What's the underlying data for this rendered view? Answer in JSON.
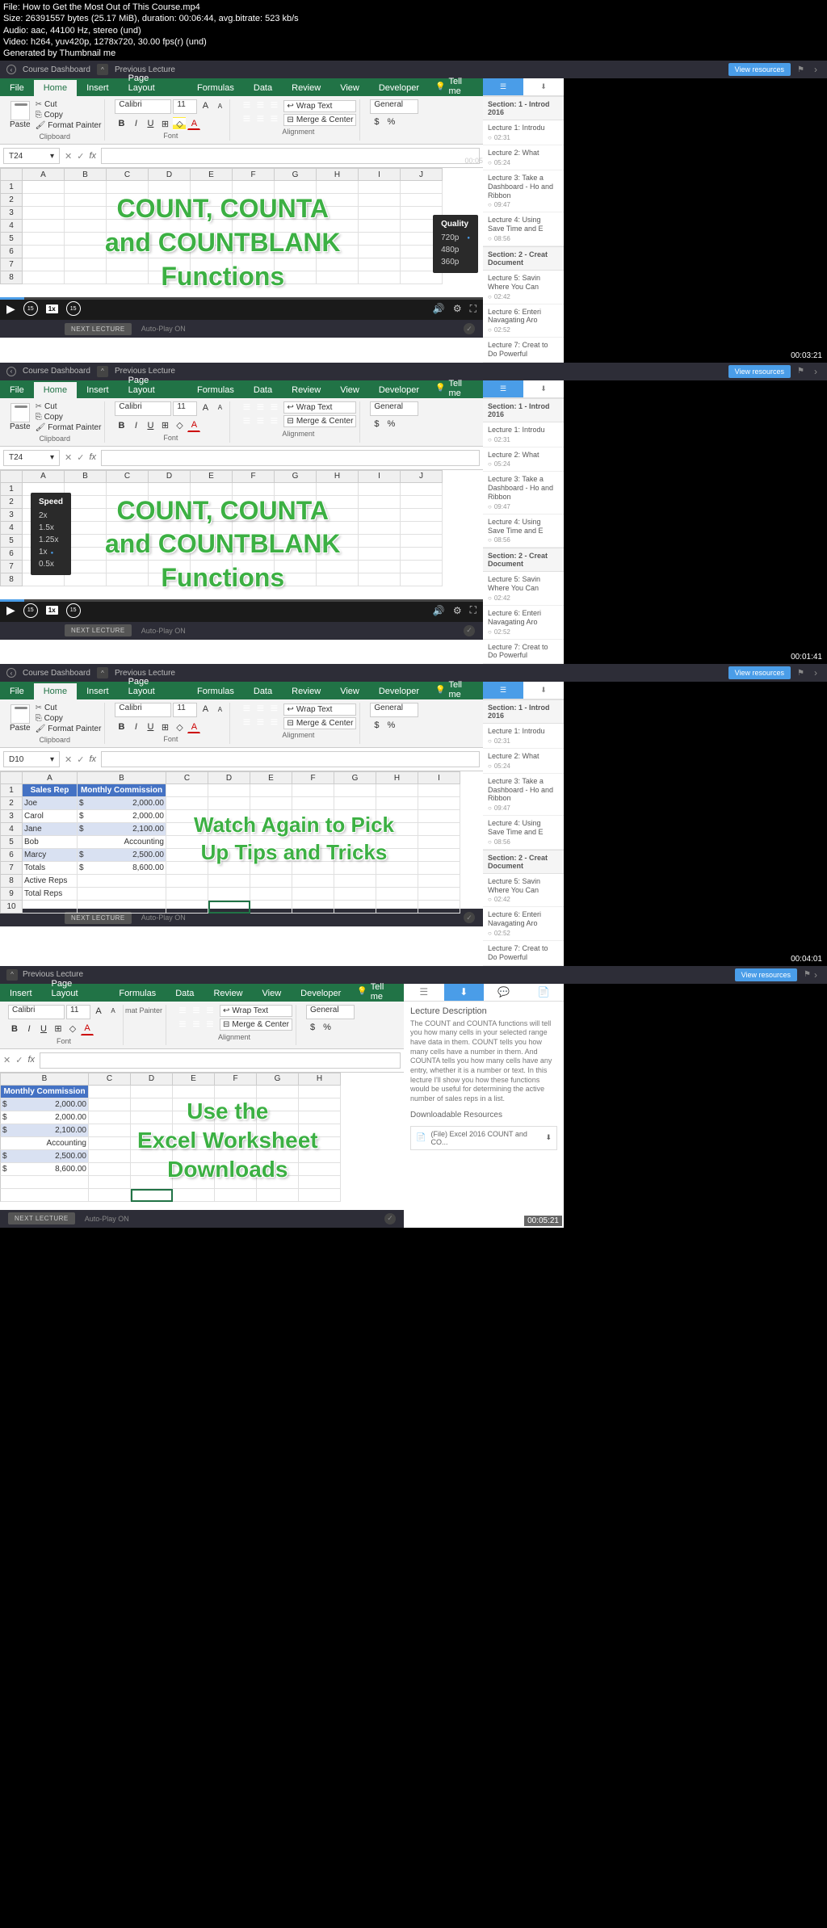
{
  "meta": {
    "file": "File: How to Get the Most Out of This Course.mp4",
    "size": "Size: 26391557 bytes (25.17 MiB), duration: 00:06:44, avg.bitrate: 523 kb/s",
    "audio": "Audio: aac, 44100 Hz, stereo (und)",
    "video": "Video: h264, yuv420p, 1278x720, 30.00 fps(r) (und)",
    "gen": "Generated by Thumbnail me"
  },
  "topbar": {
    "dashboard": "Course Dashboard",
    "prev": "Previous Lecture",
    "viewres": "View resources"
  },
  "excel": {
    "tabs": {
      "file": "File",
      "home": "Home",
      "insert": "Insert",
      "pagelayout": "Page Layout",
      "formulas": "Formulas",
      "data": "Data",
      "review": "Review",
      "view": "View",
      "developer": "Developer",
      "tellme": "Tell me"
    },
    "clipboard": {
      "paste": "Paste",
      "cut": "Cut",
      "copy": "Copy",
      "painter": "Format Painter",
      "label": "Clipboard"
    },
    "font": {
      "name": "Calibri",
      "size": "11",
      "label": "Font"
    },
    "alignment": {
      "wrap": "Wrap Text",
      "merge": "Merge & Center",
      "label": "Alignment"
    },
    "number": {
      "general": "General"
    },
    "namebox1": "T24",
    "namebox3": "D10"
  },
  "cols": [
    "A",
    "B",
    "C",
    "D",
    "E",
    "F",
    "G",
    "H",
    "I",
    "J"
  ],
  "overlay1": {
    "l1": "COUNT, COUNTA",
    "l2": "and COUNTBLANK",
    "l3": "Functions"
  },
  "overlay3": {
    "l1": "Watch Again to Pick",
    "l2": "Up Tips and Tricks"
  },
  "overlay4": {
    "l1": "Use the",
    "l2": "Excel Worksheet",
    "l3": "Downloads"
  },
  "quality": {
    "title": "Quality",
    "q720": "720p",
    "q480": "480p",
    "q360": "360p"
  },
  "speed": {
    "title": "Speed",
    "s2": "2x",
    "s15": "1.5x",
    "s125": "1.25x",
    "s1": "1x",
    "s05": "0.5x"
  },
  "controls": {
    "rewind": "15",
    "speed": "1x",
    "ffwd": "15"
  },
  "nextbar": {
    "next": "NEXT LECTURE",
    "autoplay": "Auto-Play ON"
  },
  "sidebar": {
    "sec1": "Section: 1 - Introd 2016",
    "l1": {
      "t": "Lecture 1: Introdu",
      "d": "02:31"
    },
    "l2": {
      "t": "Lecture 2: What",
      "d": "05:24"
    },
    "l3": {
      "t": "Lecture 3: Take a Dashboard - Ho and Ribbon",
      "d": "09:47"
    },
    "l4": {
      "t": "Lecture 4: Using Save Time and E",
      "d": "08:56"
    },
    "sec2": "Section: 2 - Creat Document",
    "l5": {
      "t": "Lecture 5: Savin Where You Can",
      "d": "02:42"
    },
    "l6": {
      "t": "Lecture 6: Enteri Navagating Aro",
      "d": "02:52"
    },
    "l7": {
      "t": "Lecture 7: Creat to Do Powerful"
    }
  },
  "timestamps": {
    "t1": "00:05",
    "t3": "00:03:21",
    "t4": "00:01:41",
    "t5": "00:04:01",
    "t6": "00:05:21"
  },
  "table": {
    "h1": "Sales Rep",
    "h2": "Monthly Commission",
    "r1": {
      "name": "Joe",
      "cur": "$",
      "val": "2,000.00"
    },
    "r2": {
      "name": "Carol",
      "cur": "$",
      "val": "2,000.00"
    },
    "r3": {
      "name": "Jane",
      "cur": "$",
      "val": "2,100.00"
    },
    "r4": {
      "name": "Bob",
      "val": "Accounting"
    },
    "r5": {
      "name": "Marcy",
      "cur": "$",
      "val": "2,500.00"
    },
    "r6": {
      "name": "Totals",
      "cur": "$",
      "val": "8,600.00"
    },
    "r7": {
      "name": "Active Reps"
    },
    "r8": {
      "name": "Total Reps"
    }
  },
  "desc": {
    "title": "Lecture Description",
    "text": "The COUNT and COUNTA functions will tell you how many cells in your selected range have data in them. COUNT tells you how many cells have a number in them. And COUNTA tells you how many cells have any entry, whether it is a number or text. In this lecture I'll show you how these functions would be useful for determining the active number of sales reps in a list.",
    "dltitle": "Downloadable Resources",
    "dlfile": "(File) Excel 2016 COUNT and CO..."
  }
}
